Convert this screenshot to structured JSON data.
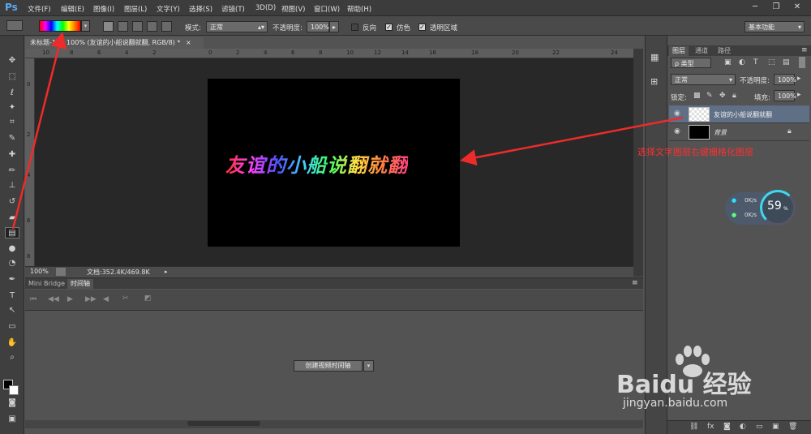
{
  "app": {
    "logo": "Ps"
  },
  "menu": [
    "文件(F)",
    "编辑(E)",
    "图像(I)",
    "图层(L)",
    "文字(Y)",
    "选择(S)",
    "滤镜(T)",
    "3D(D)",
    "视图(V)",
    "窗口(W)",
    "帮助(H)"
  ],
  "options": {
    "mode_label": "模式:",
    "mode_value": "正常",
    "opacity_label": "不透明度:",
    "opacity_value": "100%",
    "reverse_label": "反向",
    "dither_label": "仿色",
    "transparency_label": "透明区域",
    "workspace": "基本功能"
  },
  "document": {
    "tab_title": "未标题-1 @ 100% (友谊的小船说翻就翻, RGB/8) *",
    "tab_close": "×",
    "canvas_text": "友谊的小船说翻就翻",
    "zoom": "100%",
    "doc_size": "文档:352.4K/469.8K",
    "ruler_top": [
      "10",
      "8",
      "6",
      "4",
      "2",
      "0",
      "2",
      "4",
      "6",
      "8",
      "10",
      "12",
      "14",
      "16",
      "18",
      "20",
      "22",
      "24"
    ],
    "ruler_left": [
      "0",
      "2",
      "4",
      "6",
      "8"
    ]
  },
  "timeline": {
    "tab_bridge": "Mini Bridge",
    "tab_timeline": "时间轴",
    "create_button": "创建视频时间轴"
  },
  "layers": {
    "tab_layers": "图层",
    "tab_channels": "通道",
    "tab_paths": "路径",
    "filter_kind": "ρ 类型",
    "blend_mode": "正常",
    "opacity_label": "不透明度:",
    "opacity_value": "100%",
    "lock_label": "锁定:",
    "fill_label": "填充:",
    "fill_value": "100%",
    "items": [
      {
        "name": "友谊的小船说翻就翻",
        "selected": true
      },
      {
        "name": "背景",
        "selected": false
      }
    ]
  },
  "annotation": "选择文字图层右键栅格化图层",
  "net_widget": {
    "up": "0K/s",
    "down": "0K/s",
    "percent": "59",
    "unit": "%"
  },
  "watermark": {
    "brand": "Baidu 经验",
    "url": "jingyan.baidu.com"
  },
  "colors": {
    "accent": "#ff3030",
    "selected_layer": "#5f6f86",
    "canvas": "#000000"
  }
}
